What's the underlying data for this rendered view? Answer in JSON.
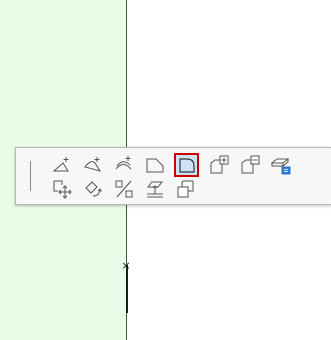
{
  "window": {
    "width": 331,
    "height": 340
  },
  "colors": {
    "canvas_bg": "#ffffff",
    "slab_fill": "#e8fce8",
    "wall_line": "#3a5a3a",
    "palette_bg": "#f7f7f7",
    "selection_outline": "#cc0000",
    "selection_fill": "#cfe3f7"
  },
  "palette": {
    "row1": [
      {
        "icon": "insert-node-icon"
      },
      {
        "icon": "insert-arc-node-icon"
      },
      {
        "icon": "offset-edge-icon"
      },
      {
        "icon": "chamfer-corner-icon"
      },
      {
        "icon": "fillet-corner-icon",
        "selected": true
      },
      {
        "icon": "add-to-polygon-icon"
      },
      {
        "icon": "subtract-from-polygon-icon"
      },
      {
        "icon": "edit-slab-settings-icon"
      }
    ],
    "row2": [
      {
        "icon": "drag-move-icon"
      },
      {
        "icon": "rotate-icon"
      },
      {
        "icon": "mirror-icon"
      },
      {
        "icon": "elevate-icon"
      },
      {
        "icon": "resize-offset-icon"
      }
    ]
  },
  "canvas": {
    "hotspot_marker": "×"
  }
}
